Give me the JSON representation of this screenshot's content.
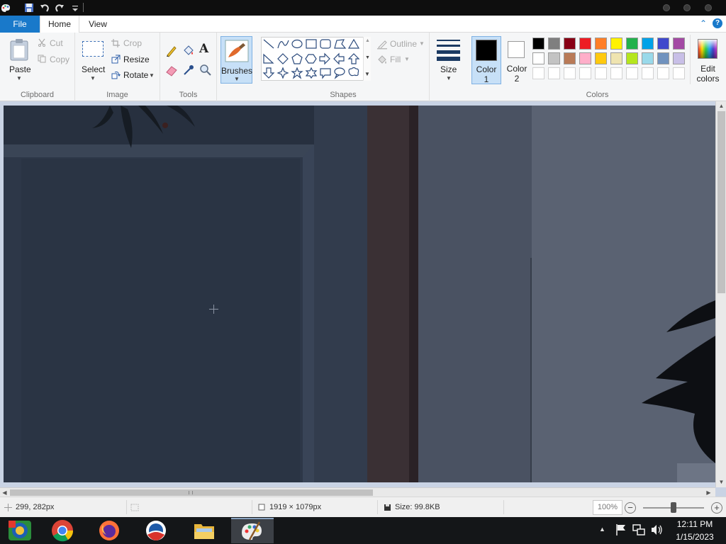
{
  "titlebar": {
    "quick_access": [
      "paint-app-icon",
      "save-icon",
      "undo-icon",
      "redo-icon",
      "customize-qat-icon"
    ]
  },
  "tabs": {
    "file": "File",
    "home": "Home",
    "view": "View"
  },
  "clipboard": {
    "paste": "Paste",
    "cut": "Cut",
    "copy": "Copy",
    "group_label": "Clipboard"
  },
  "image": {
    "select": "Select",
    "crop": "Crop",
    "resize": "Resize",
    "rotate": "Rotate",
    "group_label": "Image"
  },
  "tools": {
    "group_label": "Tools"
  },
  "brushes": {
    "label": "Brushes"
  },
  "shapes": {
    "outline": "Outline",
    "fill": "Fill",
    "group_label": "Shapes"
  },
  "size": {
    "label": "Size"
  },
  "colors": {
    "color1_label": "Color\n1",
    "color2_label": "Color\n2",
    "color1_value": "#000000",
    "color2_value": "#ffffff",
    "edit_colors": "Edit colors",
    "group_label": "Colors",
    "palette_row1": [
      "#000000",
      "#7f7f7f",
      "#880015",
      "#ed1c24",
      "#ff7f27",
      "#fff200",
      "#22b14c",
      "#00a2e8",
      "#3f48cc",
      "#a349a4"
    ],
    "palette_row2": [
      "#ffffff",
      "#c3c3c3",
      "#b97a57",
      "#ffaec9",
      "#ffc90e",
      "#efe4b0",
      "#b5e61d",
      "#99d9ea",
      "#7092be",
      "#c8bfe7"
    ]
  },
  "status": {
    "cursor_pos": "299, 282px",
    "image_size": "1919 × 1079px",
    "file_size": "Size: 99.8KB",
    "zoom": "100%"
  },
  "taskbar": {
    "apps": [
      "start-button",
      "chrome-icon",
      "firefox-icon",
      "obama-logo-icon",
      "file-explorer-icon",
      "paint-taskbar-icon"
    ],
    "time": "12:11 PM",
    "date": "1/15/2023"
  }
}
